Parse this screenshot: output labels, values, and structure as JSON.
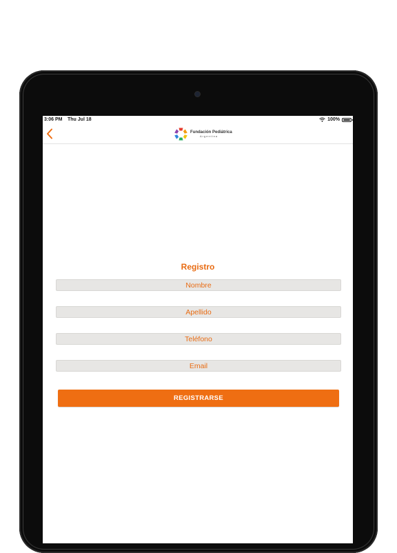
{
  "status_bar": {
    "time": "3:06 PM",
    "date": "Thu Jul 18",
    "battery": "100%"
  },
  "header": {
    "logo_title": "Fundación Pediátrica",
    "logo_subtitle": "Argentina"
  },
  "form": {
    "title": "Registro",
    "fields": [
      {
        "placeholder": "Nombre",
        "value": ""
      },
      {
        "placeholder": "Apellido",
        "value": ""
      },
      {
        "placeholder": "Teléfono",
        "value": ""
      },
      {
        "placeholder": "Email",
        "value": ""
      }
    ],
    "submit_label": "REGISTRARSE"
  },
  "colors": {
    "accent": "#ef6e12",
    "field_background": "#e7e6e4"
  },
  "icons": [
    "back-chevron-icon",
    "wifi-icon",
    "battery-icon",
    "foundation-logo-icon"
  ]
}
